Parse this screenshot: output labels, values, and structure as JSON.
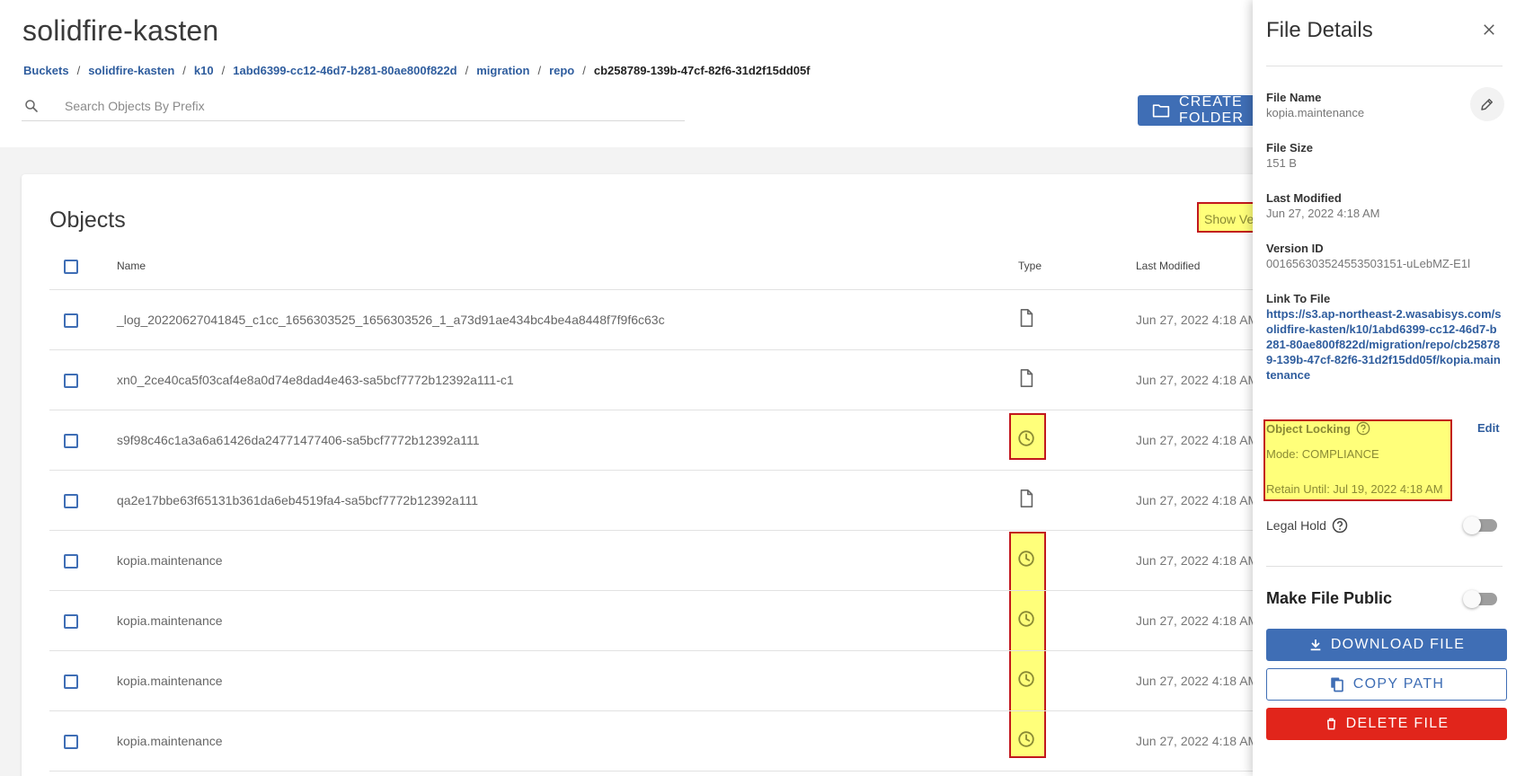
{
  "header": {
    "title": "solidfire-kasten",
    "breadcrumb": [
      "Buckets",
      "solidfire-kasten",
      "k10",
      "1abd6399-cc12-46d7-b281-80ae800f822d",
      "migration",
      "repo"
    ],
    "breadcrumb_current": "cb258789-139b-47cf-82f6-31d2f15dd05f",
    "search_placeholder": "Search Objects By Prefix",
    "create_button_label": "CREATE FOLDER"
  },
  "objects": {
    "title": "Objects",
    "show_versions_label": "Show Versions",
    "columns": {
      "name": "Name",
      "type": "Type",
      "last_modified": "Last Modified"
    },
    "rows": [
      {
        "name": "_log_20220627041845_c1cc_1656303525_1656303526_1_a73d91ae434bc4be4a8448f7f9f6c63c",
        "type_icon": "file-icon",
        "last_modified": "Jun 27, 2022 4:18 AM"
      },
      {
        "name": "xn0_2ce40ca5f03caf4e8a0d74e8dad4e463-sa5bcf7772b12392a111-c1",
        "type_icon": "file-icon",
        "last_modified": "Jun 27, 2022 4:18 AM"
      },
      {
        "name": "s9f98c46c1a3a6a61426da24771477406-sa5bcf7772b12392a111",
        "type_icon": "clock-icon",
        "last_modified": "Jun 27, 2022 4:18 AM"
      },
      {
        "name": "qa2e17bbe63f65131b361da6eb4519fa4-sa5bcf7772b12392a111",
        "type_icon": "file-icon",
        "last_modified": "Jun 27, 2022 4:18 AM"
      },
      {
        "name": "kopia.maintenance",
        "type_icon": "clock-icon",
        "last_modified": "Jun 27, 2022 4:18 AM"
      },
      {
        "name": "kopia.maintenance",
        "type_icon": "clock-icon",
        "last_modified": "Jun 27, 2022 4:18 AM"
      },
      {
        "name": "kopia.maintenance",
        "type_icon": "clock-icon",
        "last_modified": "Jun 27, 2022 4:18 AM"
      },
      {
        "name": "kopia.maintenance",
        "type_icon": "clock-icon",
        "last_modified": "Jun 27, 2022 4:18 AM"
      }
    ]
  },
  "drawer": {
    "title": "File Details",
    "file_name_label": "File Name",
    "file_name": "kopia.maintenance",
    "file_size_label": "File Size",
    "file_size": "151 B",
    "last_modified_label": "Last Modified",
    "last_modified": "Jun 27, 2022 4:18 AM",
    "version_id_label": "Version ID",
    "version_id": "001656303524553503151-uLebMZ-E1l",
    "link_label": "Link To File",
    "link": "https://s3.ap-northeast-2.wasabisys.com/solidfire-kasten/k10/1abd6399-cc12-46d7-b281-80ae800f822d/migration/repo/cb258789-139b-47cf-82f6-31d2f15dd05f/kopia.maintenance",
    "object_locking_label": "Object Locking",
    "object_locking_edit": "Edit",
    "lock_mode": "Mode: COMPLIANCE",
    "lock_retain": "Retain Until: Jul 19, 2022 4:18 AM",
    "legal_hold_label": "Legal Hold",
    "legal_hold_on": false,
    "make_public_label": "Make File Public",
    "make_public_on": false,
    "download_label": "DOWNLOAD FILE",
    "copy_label": "COPY PATH",
    "delete_label": "DELETE FILE"
  },
  "colors": {
    "primary": "#3f6eb5",
    "danger": "#e1251b",
    "highlight_fill": "#ffff7a",
    "highlight_border": "#c2181d"
  }
}
